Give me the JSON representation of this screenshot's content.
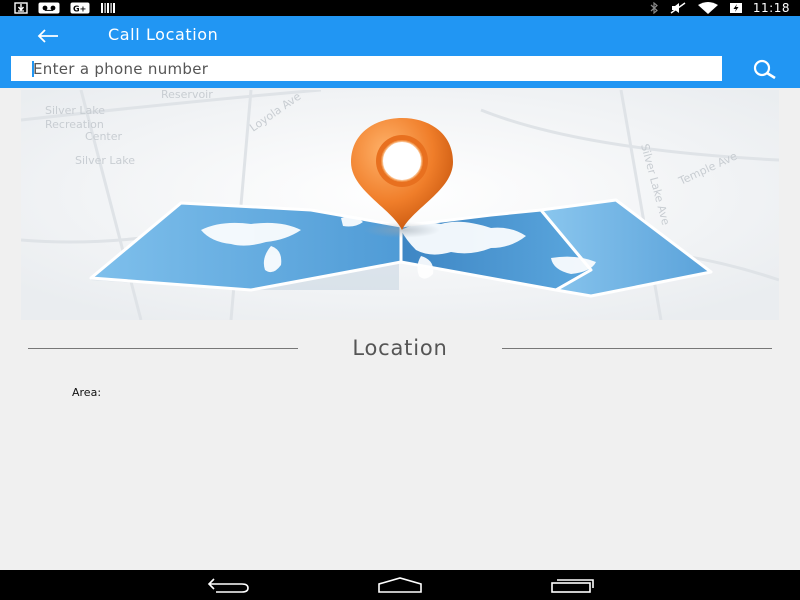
{
  "status_bar": {
    "time": "11:18",
    "icons": [
      "download-icon",
      "voicemail-icon",
      "gplus-icon",
      "barcode-icon",
      "bluetooth-icon",
      "mute-icon",
      "wifi-icon",
      "battery-icon"
    ]
  },
  "toolbar": {
    "title": "Call Location",
    "back_icon": "arrow-left-icon",
    "search_icon": "search-icon",
    "background_color": "#2196f3"
  },
  "search": {
    "placeholder": "Enter a phone number",
    "value": ""
  },
  "banner": {
    "map_labels": [
      "Silver Lake",
      "Recreation",
      "Center",
      "Silver Lake",
      "Reservoir",
      "Loyola Ave",
      "Silver Lake Ave",
      "Temple Ave"
    ],
    "pin_color": "#f07e2a",
    "map_color": "#5aa7dd"
  },
  "location": {
    "heading": "Location",
    "area_label": "Area:"
  },
  "nav_bar": {
    "icons": [
      "back-nav-icon",
      "home-nav-icon",
      "recents-nav-icon"
    ]
  }
}
